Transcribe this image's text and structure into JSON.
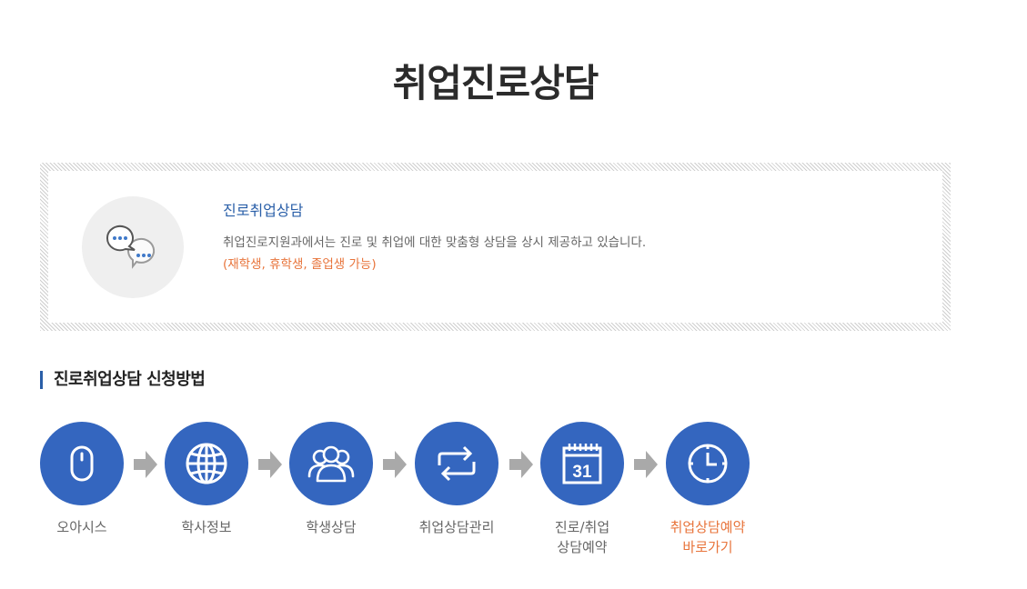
{
  "page": {
    "title": "취업진로상담"
  },
  "intro": {
    "heading": "진로취업상담",
    "description": "취업진로지원과에서는 진로 및 취업에 대한 맞춤형 상담을 상시 제공하고 있습니다.",
    "note": "(재학생, 휴학생, 졸업생 가능)",
    "icon": "chat-bubbles-icon"
  },
  "section": {
    "title": "진로취업상담 신청방법"
  },
  "steps": [
    {
      "label": "오아시스",
      "icon": "mouse-icon"
    },
    {
      "label": "학사정보",
      "icon": "globe-icon"
    },
    {
      "label": "학생상담",
      "icon": "people-icon"
    },
    {
      "label": "취업상담관리",
      "icon": "repeat-icon"
    },
    {
      "label": "진로/취업\n상담예약",
      "icon": "calendar-icon",
      "calendar_day": "31"
    },
    {
      "label": "취업상담예약\n바로가기",
      "icon": "clock-icon"
    }
  ],
  "colors": {
    "primary": "#3466bf",
    "accent": "#e8743b",
    "heading_blue": "#2a5fa8",
    "arrow": "#a9a9a9"
  }
}
